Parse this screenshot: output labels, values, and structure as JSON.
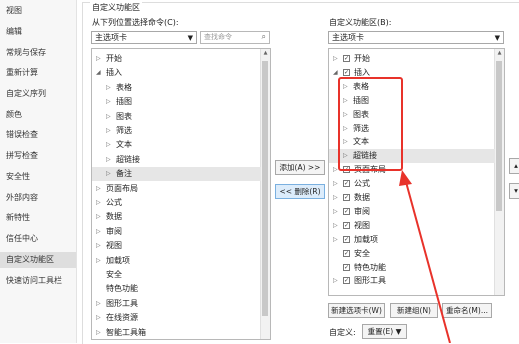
{
  "nav": {
    "items": [
      "视图",
      "编辑",
      "常规与保存",
      "重新计算",
      "自定义序列",
      "颜色",
      "错误检查",
      "拼写检查",
      "安全性",
      "外部内容",
      "新特性",
      "信任中心",
      "自定义功能区",
      "快速访问工具栏"
    ],
    "selected_index": 12
  },
  "group_title": "自定义功能区",
  "left": {
    "label": "从下列位置选择命令(C):",
    "dropdown": "主选项卡",
    "search_placeholder": "查找命令",
    "items": [
      {
        "text": "开始",
        "level": 0,
        "expand": "▷"
      },
      {
        "text": "插入",
        "level": 0,
        "expand": "◢"
      },
      {
        "text": "表格",
        "level": 1,
        "expand": "▷"
      },
      {
        "text": "插图",
        "level": 1,
        "expand": "▷"
      },
      {
        "text": "图表",
        "level": 1,
        "expand": "▷"
      },
      {
        "text": "筛选",
        "level": 1,
        "expand": "▷"
      },
      {
        "text": "文本",
        "level": 1,
        "expand": "▷"
      },
      {
        "text": "超链接",
        "level": 1,
        "expand": "▷"
      },
      {
        "text": "备注",
        "level": 1,
        "expand": "▷",
        "selected": true
      },
      {
        "text": "页面布局",
        "level": 0,
        "expand": "▷"
      },
      {
        "text": "公式",
        "level": 0,
        "expand": "▷"
      },
      {
        "text": "数据",
        "level": 0,
        "expand": "▷"
      },
      {
        "text": "审阅",
        "level": 0,
        "expand": "▷"
      },
      {
        "text": "视图",
        "level": 0,
        "expand": "▷"
      },
      {
        "text": "加载项",
        "level": 0,
        "expand": "▷"
      },
      {
        "text": "安全",
        "level": 0,
        "expand": ""
      },
      {
        "text": "特色功能",
        "level": 0,
        "expand": ""
      },
      {
        "text": "图形工具",
        "level": 0,
        "expand": "▷"
      },
      {
        "text": "在线资源",
        "level": 0,
        "expand": "▷"
      },
      {
        "text": "智能工具箱",
        "level": 0,
        "expand": "▷"
      }
    ]
  },
  "middle": {
    "add_label": "添加(A) >>",
    "remove_label": "<< 删除(R)"
  },
  "right": {
    "label": "自定义功能区(B):",
    "dropdown": "主选项卡",
    "items": [
      {
        "text": "开始",
        "level": 0,
        "expand": "▷",
        "check": true
      },
      {
        "text": "插入",
        "level": 0,
        "expand": "◢",
        "check": true
      },
      {
        "text": "表格",
        "level": 1,
        "expand": "▷"
      },
      {
        "text": "插图",
        "level": 1,
        "expand": "▷"
      },
      {
        "text": "图表",
        "level": 1,
        "expand": "▷"
      },
      {
        "text": "筛选",
        "level": 1,
        "expand": "▷"
      },
      {
        "text": "文本",
        "level": 1,
        "expand": "▷"
      },
      {
        "text": "超链接",
        "level": 1,
        "expand": "▷",
        "selected": true
      },
      {
        "text": "页面布局",
        "level": 0,
        "expand": "▷",
        "check": true
      },
      {
        "text": "公式",
        "level": 0,
        "expand": "▷",
        "check": true
      },
      {
        "text": "数据",
        "level": 0,
        "expand": "▷",
        "check": true
      },
      {
        "text": "审阅",
        "level": 0,
        "expand": "▷",
        "check": true
      },
      {
        "text": "视图",
        "level": 0,
        "expand": "▷",
        "check": true
      },
      {
        "text": "加载项",
        "level": 0,
        "expand": "▷",
        "check": true
      },
      {
        "text": "安全",
        "level": 0,
        "expand": "",
        "check": true
      },
      {
        "text": "特色功能",
        "level": 0,
        "expand": "",
        "check": true
      },
      {
        "text": "图形工具",
        "level": 0,
        "expand": "▷",
        "check": true
      }
    ],
    "new_tab_label": "新建选项卡(W)",
    "new_group_label": "新建组(N)",
    "rename_label": "重命名(M)...",
    "custom_label": "自定义:",
    "reset_label": "重置(E)"
  },
  "annotation_color": "#e8322a"
}
